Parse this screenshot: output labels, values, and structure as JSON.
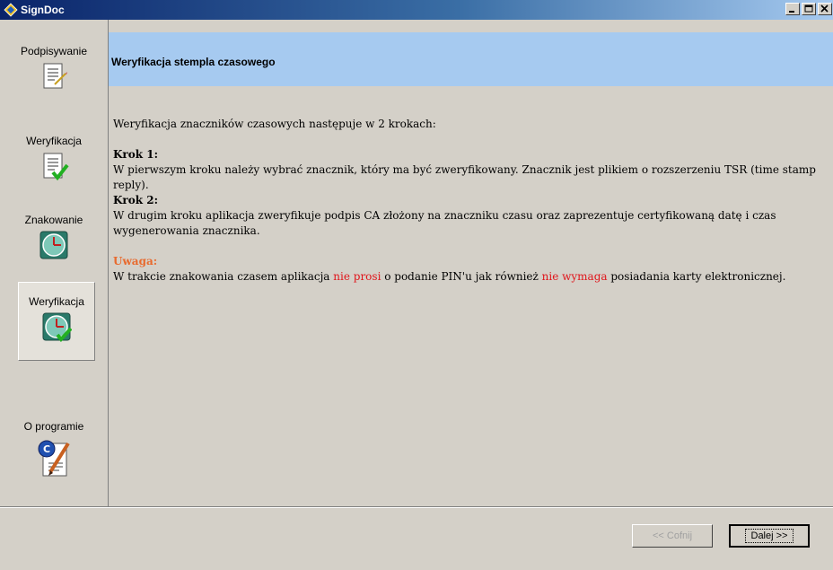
{
  "window": {
    "title": "SignDoc"
  },
  "sidebar": {
    "items": [
      {
        "label": "Podpisywanie",
        "icon": "document-sign-icon"
      },
      {
        "label": "Weryfikacja",
        "icon": "document-check-icon"
      },
      {
        "label": "Znakowanie",
        "icon": "clock-icon"
      },
      {
        "label": "Weryfikacja",
        "icon": "clock-check-icon",
        "selected": true
      },
      {
        "label": "O programie",
        "icon": "about-certificate-icon"
      }
    ]
  },
  "header": {
    "title": "Weryfikacja stempla czasowego"
  },
  "content": {
    "intro": "Weryfikacja znaczników czasowych następuje w 2 krokach:",
    "step1_title": "Krok 1:",
    "step1_text": "W pierwszym kroku należy wybrać znacznik, który ma być zweryfikowany. Znacznik jest plikiem o rozszerzeniu TSR (time stamp reply).",
    "step2_title": "Krok 2:",
    "step2_text": "W drugim kroku aplikacja zweryfikuje podpis CA złożony na znaczniku czasu oraz zaprezentuje certyfikowaną datę i czas wygenerowania znacznika.",
    "warning_title": "Uwaga:",
    "warning_part1": "W trakcie znakowania czasem aplikacja ",
    "warning_red1": "nie prosi",
    "warning_part2": " o podanie PIN'u jak również ",
    "warning_red2": "nie wymaga",
    "warning_part3": " posiadania karty elektronicznej."
  },
  "buttons": {
    "back_label": "<< Cofnij",
    "next_label": "Dalej >>"
  },
  "colors": {
    "header_bg": "#a6caf0",
    "warning_title": "#e86a2e",
    "warning_emphasis": "#e0151b"
  }
}
